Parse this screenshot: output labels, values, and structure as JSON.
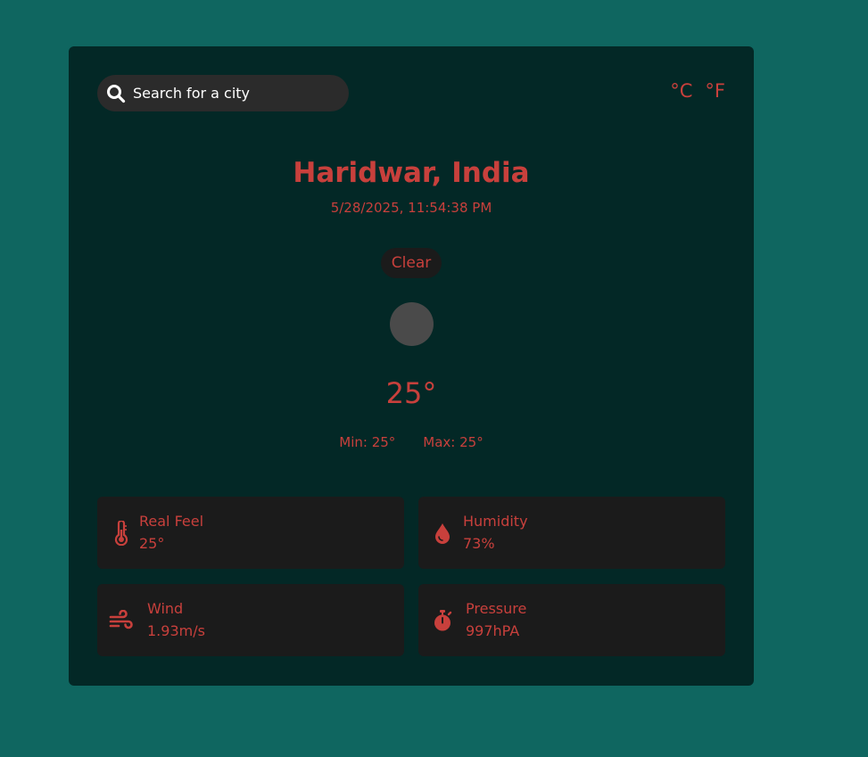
{
  "search": {
    "placeholder": "Search for a city"
  },
  "units": {
    "celsius": "°C",
    "fahrenheit": "°F"
  },
  "location": {
    "city": "Haridwar, India",
    "datetime": "5/28/2025, 11:54:38 PM"
  },
  "weather": {
    "condition": "Clear",
    "icon": "weather-icon-placeholder",
    "temperature": "25°",
    "min": "Min: 25°",
    "max": "Max: 25°"
  },
  "details": [
    {
      "label": "Real Feel",
      "value": "25°",
      "icon": "thermometer-icon"
    },
    {
      "label": "Humidity",
      "value": "73%",
      "icon": "droplet-icon"
    },
    {
      "label": "Wind",
      "value": "1.93m/s",
      "icon": "wind-icon"
    },
    {
      "label": "Pressure",
      "value": "997hPA",
      "icon": "stopwatch-icon"
    }
  ],
  "colors": {
    "background": "#0f6660",
    "card": "#032826",
    "accent": "#c8403c",
    "tile": "#1b1b1b",
    "search": "#2b2b2b"
  }
}
